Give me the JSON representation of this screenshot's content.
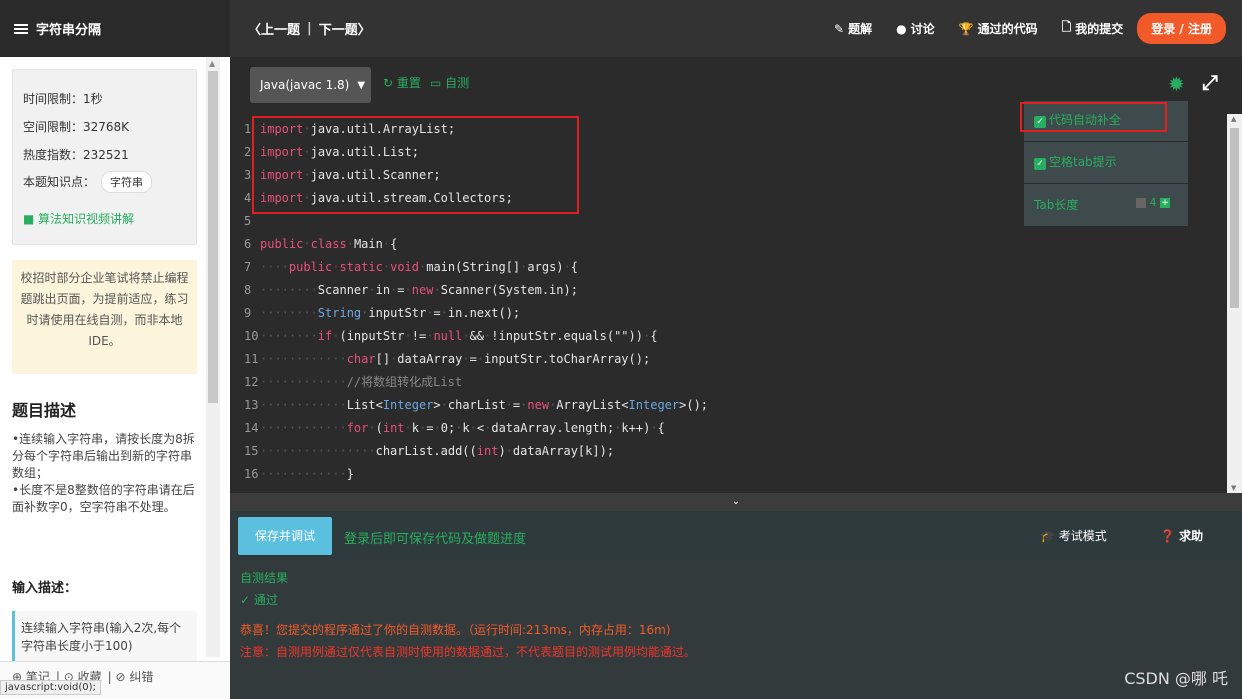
{
  "topbar": {
    "title": "字符串分隔",
    "prev": "〈上一题",
    "sep": "|",
    "next": "下一题〉",
    "links": [
      {
        "icon": "✎",
        "label": "题解"
      },
      {
        "icon": "●",
        "label": "讨论"
      },
      {
        "icon": "🏆",
        "label": "通过的代码"
      },
      {
        "icon": "🗋",
        "label": "我的提交"
      }
    ],
    "login": "登录 / 注册"
  },
  "info": {
    "time_limit": "时间限制：1秒",
    "space_limit": "空间限制：32768K",
    "heat": "热度指数：232521",
    "knowledge_label": "本题知识点：",
    "knowledge_tag": "字符串",
    "video": "算法知识视频讲解"
  },
  "warning": "校招时部分企业笔试将禁止编程题跳出页面，为提前适应，练习时请使用在线自测，而非本地IDE。",
  "description": {
    "title": "题目描述",
    "lines": [
      "•连续输入字符串，请按长度为8拆分每个字符串后输出到新的字符串数组；",
      "•长度不是8整数倍的字符串请在后面补数字0，空字符串不处理。"
    ]
  },
  "input": {
    "title": "输入描述：",
    "text": "连续输入字符串(输入2次,每个字符串长度小于100)"
  },
  "left_bottom": {
    "items": [
      "⊕ 笔记",
      "⊙ 收藏",
      "⊘ 纠错"
    ],
    "status_tip": "javascript:void(0);"
  },
  "editor": {
    "language": "Java(javac 1.8)",
    "reset": "重置",
    "selftest": "自测",
    "settings": {
      "autocomplete": "代码自动补全",
      "tab_hint": "空格tab提示",
      "tab_length_label": "Tab长度",
      "tab_length": "4"
    },
    "lines": [
      {
        "n": "1",
        "t": "<span class=\"kw\">import</span><span class=\"dot\">·</span>java.util.ArrayList;"
      },
      {
        "n": "2",
        "t": "<span class=\"kw\">import</span><span class=\"dot\">·</span>java.util.List;"
      },
      {
        "n": "3",
        "t": "<span class=\"kw\">import</span><span class=\"dot\">·</span>java.util.Scanner;"
      },
      {
        "n": "4",
        "t": "<span class=\"kw\">import</span><span class=\"dot\">·</span>java.util.stream.Collectors;"
      },
      {
        "n": "5",
        "t": ""
      },
      {
        "n": "6",
        "t": "<span class=\"kw\">public</span><span class=\"dot\">·</span><span class=\"kw\">class</span><span class=\"dot\">·</span>Main<span class=\"dot\">·</span>{"
      },
      {
        "n": "7",
        "t": "<span class=\"dot\">····</span><span class=\"kw\">public</span><span class=\"dot\">·</span><span class=\"kw\">static</span><span class=\"dot\">·</span><span class=\"kw\">void</span><span class=\"dot\">·</span>main(String[]<span class=\"dot\">·</span>args)<span class=\"dot\">·</span>{"
      },
      {
        "n": "8",
        "t": "<span class=\"dot\">········</span>Scanner<span class=\"dot\">·</span>in<span class=\"dot\">·</span>=<span class=\"dot\">·</span><span class=\"kw\">new</span><span class=\"dot\">·</span>Scanner(System.in);"
      },
      {
        "n": "9",
        "t": "<span class=\"dot\">········</span><span class=\"ty\">String</span><span class=\"dot\">·</span>inputStr<span class=\"dot\">·</span>=<span class=\"dot\">·</span>in.next();"
      },
      {
        "n": "10",
        "t": "<span class=\"dot\">········</span><span class=\"kw\">if</span><span class=\"dot\">·</span>(inputStr<span class=\"dot\">·</span>!=<span class=\"dot\">·</span><span class=\"kw\">null</span><span class=\"dot\">·</span>&amp;&amp;<span class=\"dot\">·</span>!inputStr.equals(\"\"))<span class=\"dot\">·</span>{"
      },
      {
        "n": "11",
        "t": "<span class=\"dot\">············</span><span class=\"kw\">char</span>[]<span class=\"dot\">·</span>dataArray<span class=\"dot\">·</span>=<span class=\"dot\">·</span>inputStr.toCharArray();"
      },
      {
        "n": "12",
        "t": "<span class=\"dot\">············</span><span class=\"cm\">//将数组转化成List</span>"
      },
      {
        "n": "13",
        "t": "<span class=\"dot\">············</span>List&lt;<span class=\"ty\">Integer</span>&gt;<span class=\"dot\">·</span>charList<span class=\"dot\">·</span>=<span class=\"dot\">·</span><span class=\"kw\">new</span><span class=\"dot\">·</span>ArrayList&lt;<span class=\"ty\">Integer</span>&gt;();"
      },
      {
        "n": "14",
        "t": "<span class=\"dot\">············</span><span class=\"kw\">for</span><span class=\"dot\">·</span>(<span class=\"kw\">int</span><span class=\"dot\">·</span>k<span class=\"dot\">·</span>=<span class=\"dot\">·</span>0;<span class=\"dot\">·</span>k<span class=\"dot\">·</span>&lt;<span class=\"dot\">·</span>dataArray.length;<span class=\"dot\">·</span>k++)<span class=\"dot\">·</span>{"
      },
      {
        "n": "15",
        "t": "<span class=\"dot\">················</span>charList.add((<span class=\"kw\">int</span>)<span class=\"dot\">·</span>dataArray[k]);"
      },
      {
        "n": "16",
        "t": "<span class=\"dot\">············</span>}"
      }
    ]
  },
  "bottom": {
    "save_button": "保存并调试",
    "save_hint": "登录后即可保存代码及做题进度",
    "exam_mode": "考试模式",
    "help": "求助",
    "result_title": "自测结果",
    "pass": "✓ 通过",
    "congrats": "恭喜！您提交的程序通过了你的自测数据。（运行时间:213ms，内存占用：16m)",
    "note": "注意：自测用例通过仅代表自测时使用的数据通过，不代表题目的测试用例均能通过。",
    "watermark": "CSDN @哪 吒"
  },
  "colors": {
    "accent_green": "#27ae60",
    "login_orange": "#f25a29",
    "highlight_red": "#e02020",
    "save_blue": "#5bc0de"
  }
}
